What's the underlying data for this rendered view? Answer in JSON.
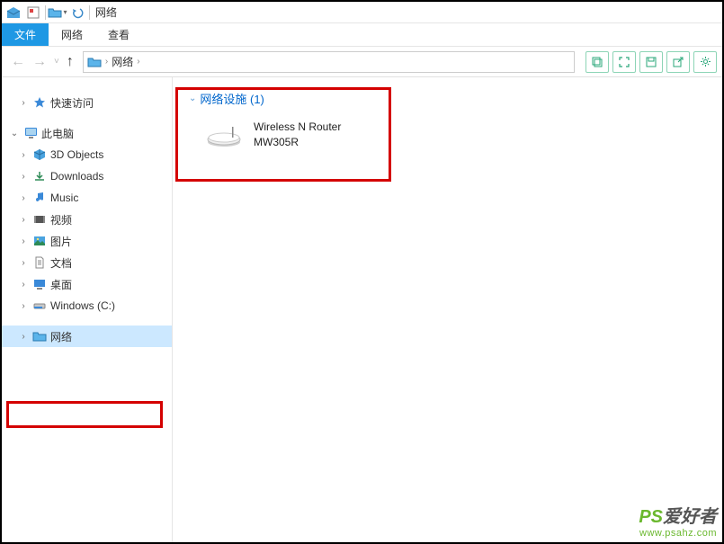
{
  "titlebar": {
    "title": "网络"
  },
  "ribbon": {
    "file": "文件",
    "network": "网络",
    "view": "查看"
  },
  "breadcrumb": {
    "root": "网络",
    "sep": "›"
  },
  "sidebar": {
    "quick_access": "快速访问",
    "this_pc": "此电脑",
    "items": [
      {
        "label": "3D Objects"
      },
      {
        "label": "Downloads"
      },
      {
        "label": "Music"
      },
      {
        "label": "视频"
      },
      {
        "label": "图片"
      },
      {
        "label": "文档"
      },
      {
        "label": "桌面"
      },
      {
        "label": "Windows (C:)"
      }
    ],
    "network": "网络"
  },
  "content": {
    "group_header": "网络设施 (1)",
    "device": {
      "line1": "Wireless N Router",
      "line2": "MW305R"
    }
  },
  "watermark": {
    "brand": "PS",
    "text": "爱好者",
    "url": "www.psahz.com"
  }
}
